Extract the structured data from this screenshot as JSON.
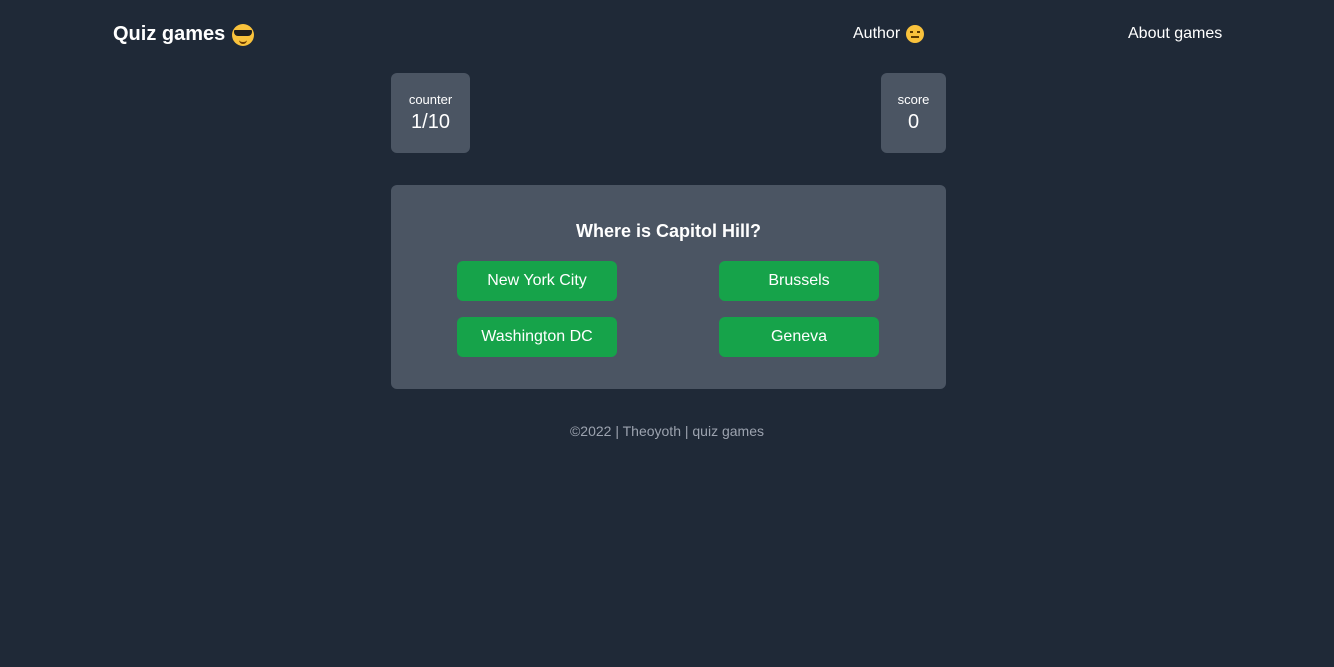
{
  "nav": {
    "brand": "Quiz games",
    "brand_icon": "sunglasses-emoji",
    "author_link": "Author",
    "author_icon": "neutral-face-emoji",
    "about_link": "About games"
  },
  "stats": {
    "counter_label": "counter",
    "counter_value": "1/10",
    "score_label": "score",
    "score_value": "0"
  },
  "quiz": {
    "question": "Where is Capitol Hill?",
    "answers": [
      "New York City",
      "Brussels",
      "Washington DC",
      "Geneva"
    ]
  },
  "footer": {
    "text": "©2022 | Theoyoth | quiz games"
  },
  "colors": {
    "background": "#1f2937",
    "card": "#4b5563",
    "answer_button": "#16a34a",
    "footer_text": "#9ca3af"
  }
}
